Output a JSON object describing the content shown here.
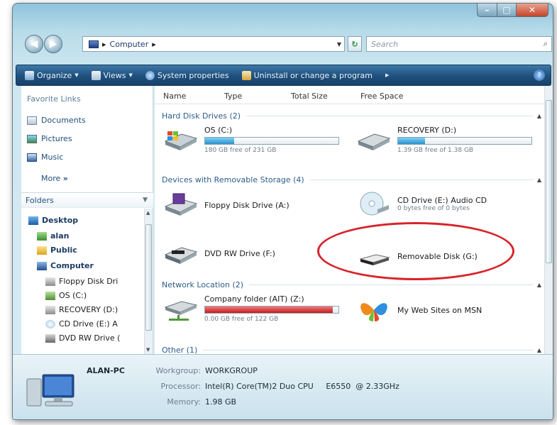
{
  "window": {
    "address": "Computer",
    "search_placeholder": "Search"
  },
  "toolbar": {
    "organize": "Organize",
    "views": "Views",
    "system_properties": "System properties",
    "uninstall": "Uninstall or change a program"
  },
  "sidebar": {
    "favorites_title": "Favorite Links",
    "favorites": [
      "Documents",
      "Pictures",
      "Music"
    ],
    "more": "More",
    "folders": "Folders",
    "tree": [
      "Desktop",
      "alan",
      "Public",
      "Computer",
      "Floppy Disk Dri",
      "OS (C:)",
      "RECOVERY (D:)",
      "CD Drive (E:) A",
      "DVD RW Drive ("
    ]
  },
  "columns": [
    "Name",
    "Type",
    "Total Size",
    "Free Space"
  ],
  "groups": {
    "hard": "Hard Disk Drives (2)",
    "removable": "Devices with Removable Storage (4)",
    "network": "Network Location (2)",
    "other": "Other (1)"
  },
  "drives": {
    "os": {
      "name": "OS (C:)",
      "free": "180 GB free of 231 GB",
      "used": 0.22
    },
    "recovery": {
      "name": "RECOVERY (D:)",
      "free": "1.39 GB free of 1.38 GB",
      "used": 0.2
    },
    "floppy": {
      "name": "Floppy Disk Drive (A:)"
    },
    "cd": {
      "name": "CD Drive (E:) Audio CD",
      "free": "0 bytes free of 0 bytes"
    },
    "dvd": {
      "name": "DVD RW Drive (F:)"
    },
    "removable": {
      "name": "Removable Disk (G:)"
    },
    "company": {
      "name": "Company folder (AIT) (Z:)",
      "free": "0.00 GB free of 122 GB",
      "used": 0.96
    },
    "msn": {
      "name": "My Web Sites on MSN"
    }
  },
  "details": {
    "computer": "ALAN-PC",
    "workgroup_label": "Workgroup:",
    "workgroup": "WORKGROUP",
    "processor_label": "Processor:",
    "processor": "Intel(R) Core(TM)2 Duo CPU     E6550  @ 2.33GHz",
    "memory_label": "Memory:",
    "memory": "1.98 GB"
  }
}
